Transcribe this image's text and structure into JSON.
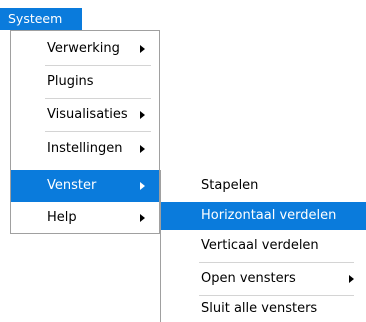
{
  "top_menu": {
    "label": "Systeem"
  },
  "menu": {
    "items": [
      {
        "label": "Verwerking",
        "submenu": true
      },
      {
        "label": "Plugins",
        "submenu": false
      },
      {
        "label": "Visualisaties",
        "submenu": true
      },
      {
        "label": "Instellingen",
        "submenu": true
      },
      {
        "label": "Venster",
        "submenu": true,
        "highlighted": true
      },
      {
        "label": "Help",
        "submenu": true
      }
    ]
  },
  "submenu": {
    "items": [
      {
        "label": "Stapelen",
        "submenu": false
      },
      {
        "label": "Horizontaal verdelen",
        "submenu": false,
        "highlighted": true
      },
      {
        "label": "Verticaal verdelen",
        "submenu": false
      },
      {
        "label": "Open vensters",
        "submenu": true
      },
      {
        "label": "Sluit alle vensters",
        "submenu": false
      }
    ]
  },
  "colors": {
    "highlight": "#0a7bdc",
    "highlight_text": "#ffffff",
    "border": "#a0a0a0",
    "separator": "#d4d4d4"
  }
}
